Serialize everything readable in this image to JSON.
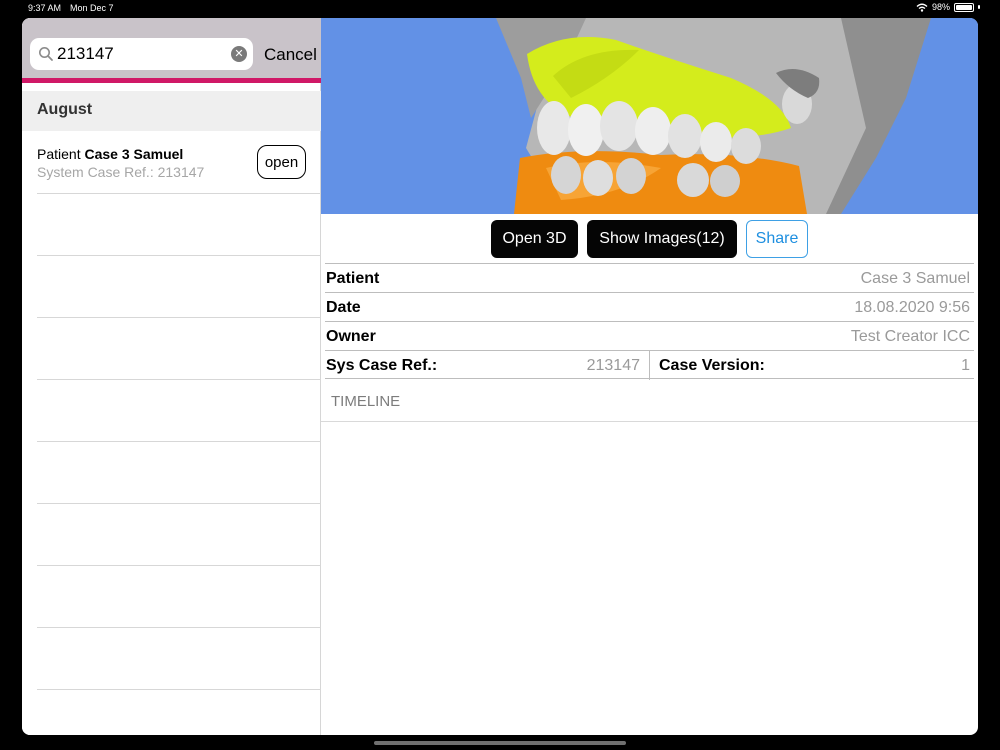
{
  "status_bar": {
    "time": "9:37 AM",
    "date": "Mon Dec 7",
    "battery": "98%"
  },
  "search": {
    "value": "213147",
    "cancel_label": "Cancel"
  },
  "list": {
    "section_title": "August",
    "items": [
      {
        "prefix": "Patient",
        "name": "Case 3 Samuel",
        "ref": "System Case Ref.: 213147",
        "action": "open"
      }
    ]
  },
  "toolbar": {
    "open3d_label": "Open 3D",
    "show_images_label": "Show Images(12)",
    "share_label": "Share"
  },
  "details": {
    "patient_label": "Patient",
    "patient_value": "Case 3 Samuel",
    "date_label": "Date",
    "date_value": "18.08.2020 9:56",
    "owner_label": "Owner",
    "owner_value": "Test Creator ICC",
    "sys_ref_label": "Sys Case Ref.:",
    "sys_ref_value": "213147",
    "version_label": "Case Version:",
    "version_value": "1"
  },
  "timeline_label": "TIMELINE",
  "colors": {
    "accent": "#d01867",
    "viewer_bg": "#6291e6",
    "share": "#1e8fe0",
    "upper_model": "#d4ec1c",
    "lower_model": "#ef8b10"
  }
}
